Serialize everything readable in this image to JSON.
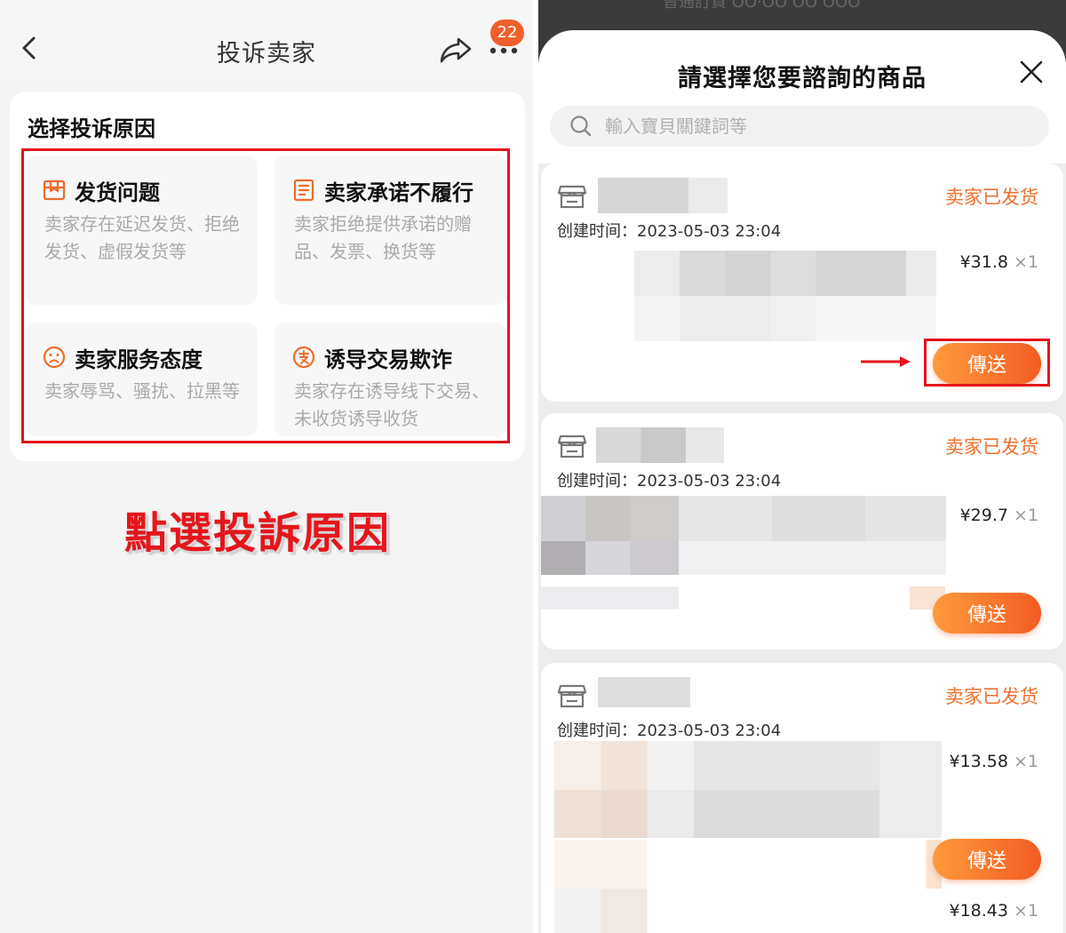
{
  "left": {
    "header": {
      "title": "投诉卖家",
      "badge_count": "22"
    },
    "reason_section": {
      "heading": "选择投诉原因",
      "items": [
        {
          "icon": "package-box-icon",
          "title": "发货问题",
          "description": "卖家存在延迟发货、拒绝发货、虚假发货等"
        },
        {
          "icon": "document-list-icon",
          "title": "卖家承诺不履行",
          "description": "卖家拒绝提供承诺的赠品、发票、换货等"
        },
        {
          "icon": "sad-face-icon",
          "title": "卖家服务态度",
          "description": "卖家辱骂、骚扰、拉黑等"
        },
        {
          "icon": "payment-circle-icon",
          "title": "诱导交易欺诈",
          "description": "卖家存在诱导线下交易、未收货诱导收货"
        }
      ]
    },
    "instruction": "點選投訴原因"
  },
  "right": {
    "background_text": "普通訂貨 OO·OO OO OOO",
    "sheet_title": "請選擇您要諮詢的商品",
    "search": {
      "placeholder": "輸入寶貝關鍵詞等",
      "value": ""
    },
    "orders": [
      {
        "status": "卖家已发货",
        "created_label": "创建时间：",
        "created_time": "2023-05-03 23:04",
        "items": [
          {
            "price": "¥31.8",
            "qty": "×1"
          }
        ],
        "send_label": "傳送"
      },
      {
        "status": "卖家已发货",
        "created_label": "创建时间：",
        "created_time": "2023-05-03 23:04",
        "items": [
          {
            "price": "¥29.7",
            "qty": "×1"
          }
        ],
        "send_label": "傳送"
      },
      {
        "status": "卖家已发货",
        "created_label": "创建时间：",
        "created_time": "2023-05-03 23:04",
        "items": [
          {
            "price": "¥13.58",
            "qty": "×1"
          },
          {
            "price": "¥18.43",
            "qty": "×1"
          }
        ],
        "send_label": "傳送"
      }
    ]
  },
  "colors": {
    "accent_orange": "#f1602a",
    "status_orange": "#ee6f2d",
    "annotation_red": "#e3121b",
    "muted_text": "#aaaaaa"
  }
}
